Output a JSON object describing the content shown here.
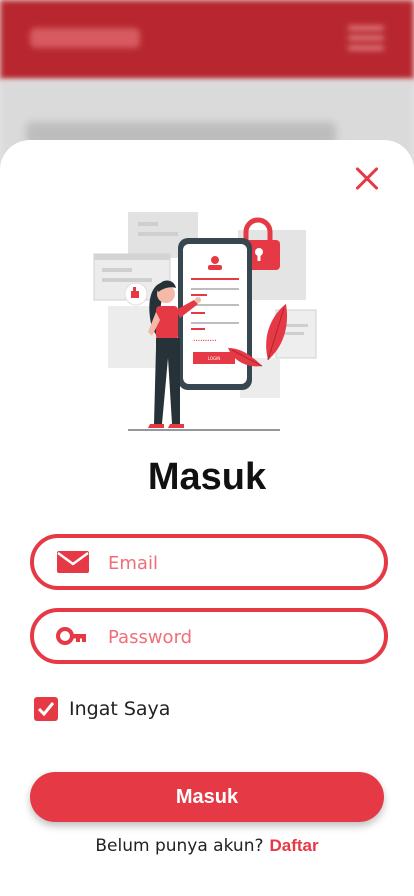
{
  "modal": {
    "title": "Masuk",
    "email_placeholder": "Email",
    "password_placeholder": "Password",
    "remember_label": "Ingat Saya",
    "remember_checked": true,
    "submit_label": "Masuk",
    "signup_prompt": "Belum punya akun?",
    "signup_link": "Daftar"
  },
  "illustration": {
    "button_label": "LOGIN"
  },
  "colors": {
    "accent": "#e63946",
    "header_bg": "#b8272f",
    "text_dark": "#111111"
  },
  "icons": [
    "close-icon",
    "mail-icon",
    "key-icon",
    "check-icon"
  ]
}
